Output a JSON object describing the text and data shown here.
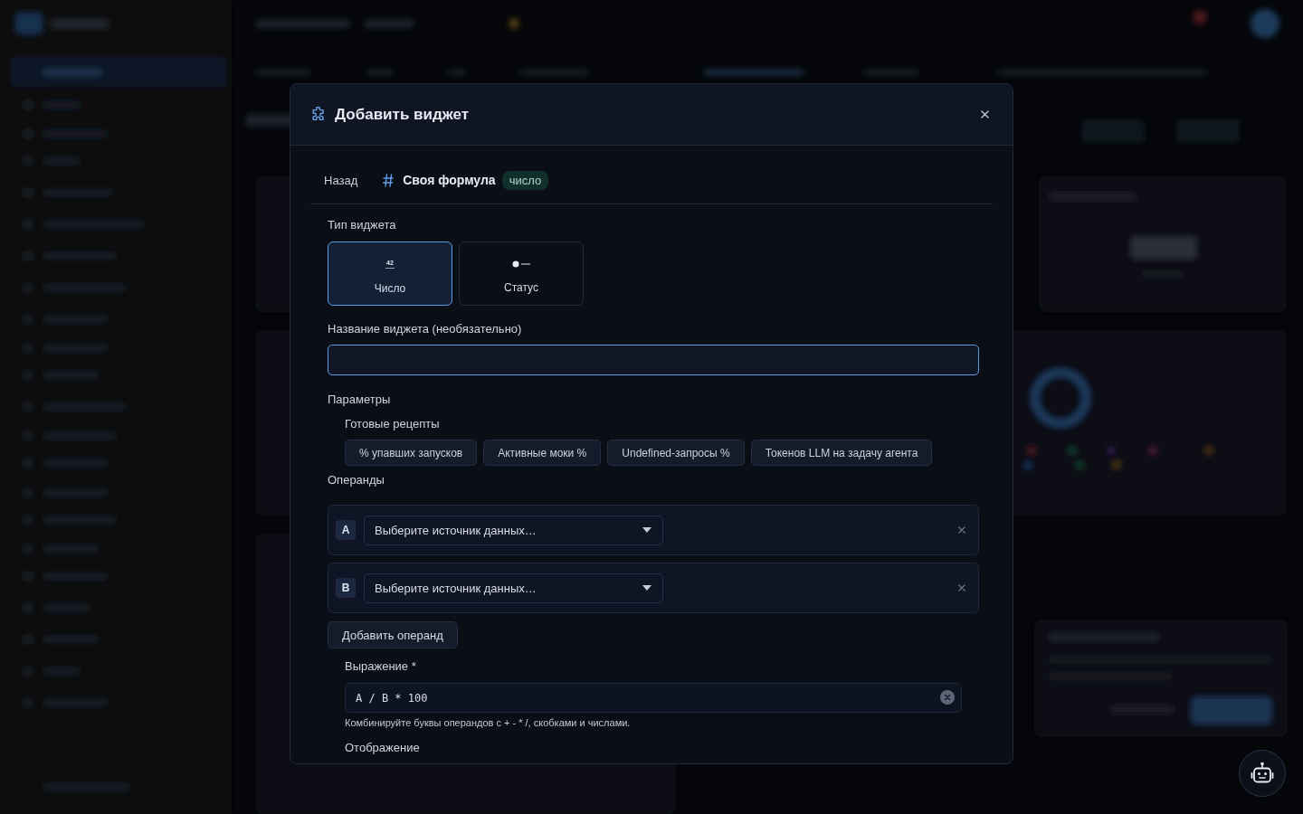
{
  "dialog": {
    "title": "Добавить виджет"
  },
  "breadcrumb": {
    "back": "Назад",
    "title": "Своя формула",
    "badge": "число"
  },
  "widget_type": {
    "label": "Тип виджета",
    "options": [
      {
        "kind": "number",
        "glyph": "42",
        "label": "Число",
        "selected": true
      },
      {
        "kind": "status",
        "label": "Статус",
        "selected": false
      }
    ]
  },
  "name_field": {
    "label": "Название виджета (необязательно)",
    "focused": true
  },
  "parameters": {
    "label": "Параметры",
    "recipes": {
      "label": "Готовые рецепты",
      "items": [
        "% упавших запусков",
        "Активные моки %",
        "Undefined-запросы %",
        "Токенов LLM на задачу агента"
      ]
    },
    "operands": {
      "label": "Операнды",
      "items": [
        {
          "letter": "A",
          "placeholder": "Выберите источник данных…"
        },
        {
          "letter": "B",
          "placeholder": "Выберите источник данных…"
        }
      ],
      "add_button": "Добавить операнд"
    },
    "expression": {
      "label": "Выражение *",
      "value": "A / B * 100",
      "hint": "Комбинируйте буквы операндов с + - * /, скобками и числами."
    },
    "display": {
      "label": "Отображение"
    }
  }
}
